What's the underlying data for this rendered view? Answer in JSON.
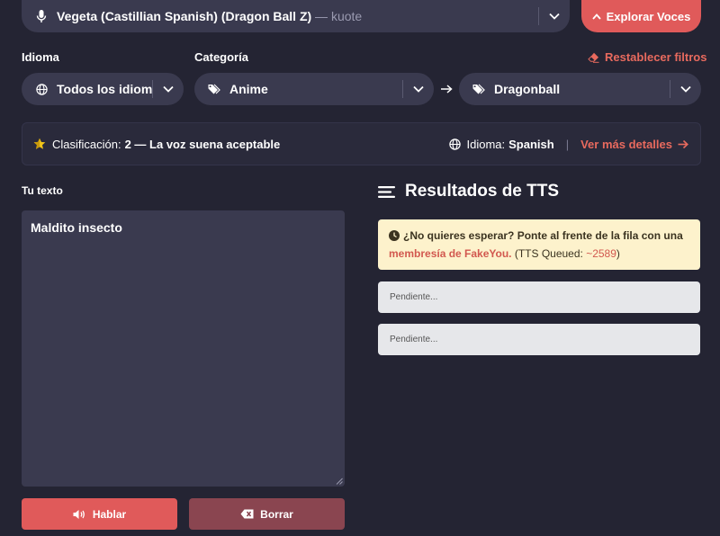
{
  "voice_select": {
    "label": "Vegeta (Castillian Spanish) (Dragon Ball Z)",
    "author_sep": " — ",
    "author": "kuote",
    "icon": "microphone-icon"
  },
  "explore_button": {
    "label": "Explorar Voces",
    "icon": "chevron-up-icon"
  },
  "filters": {
    "language_label": "Idioma",
    "category_label": "Categoría",
    "reset_label": "Restablecer filtros",
    "language_value": "Todos los idiom...",
    "category_value": "Anime",
    "subcategory_value": "Dragonball"
  },
  "info_bar": {
    "rating_label": "Clasificación:",
    "rating_value": "2 — La voz suena aceptable",
    "language_label": "Idioma:",
    "language_value": "Spanish",
    "separator": "|",
    "details_link": "Ver más detalles"
  },
  "text_section": {
    "label": "Tu texto",
    "value": "Maldito insecto"
  },
  "actions": {
    "speak_label": "Hablar",
    "clear_label": "Borrar"
  },
  "results": {
    "title": "Resultados de TTS",
    "alert_text_1": "¿No quieres esperar? Ponte al frente de la fila con una",
    "alert_link": "membresía de FakeYou.",
    "alert_text_2": " (TTS Queued: ",
    "alert_queue": "~2589",
    "alert_text_3": ")",
    "pending_1": "Pendiente...",
    "pending_2": "Pendiente..."
  },
  "colors": {
    "background": "#242433",
    "panel": "#3a3a4f",
    "accent": "#e05a5a",
    "accent_dark": "#8a4550",
    "link": "#e86a5e",
    "star": "#f0c419",
    "alert_bg": "#fdf2cc"
  }
}
